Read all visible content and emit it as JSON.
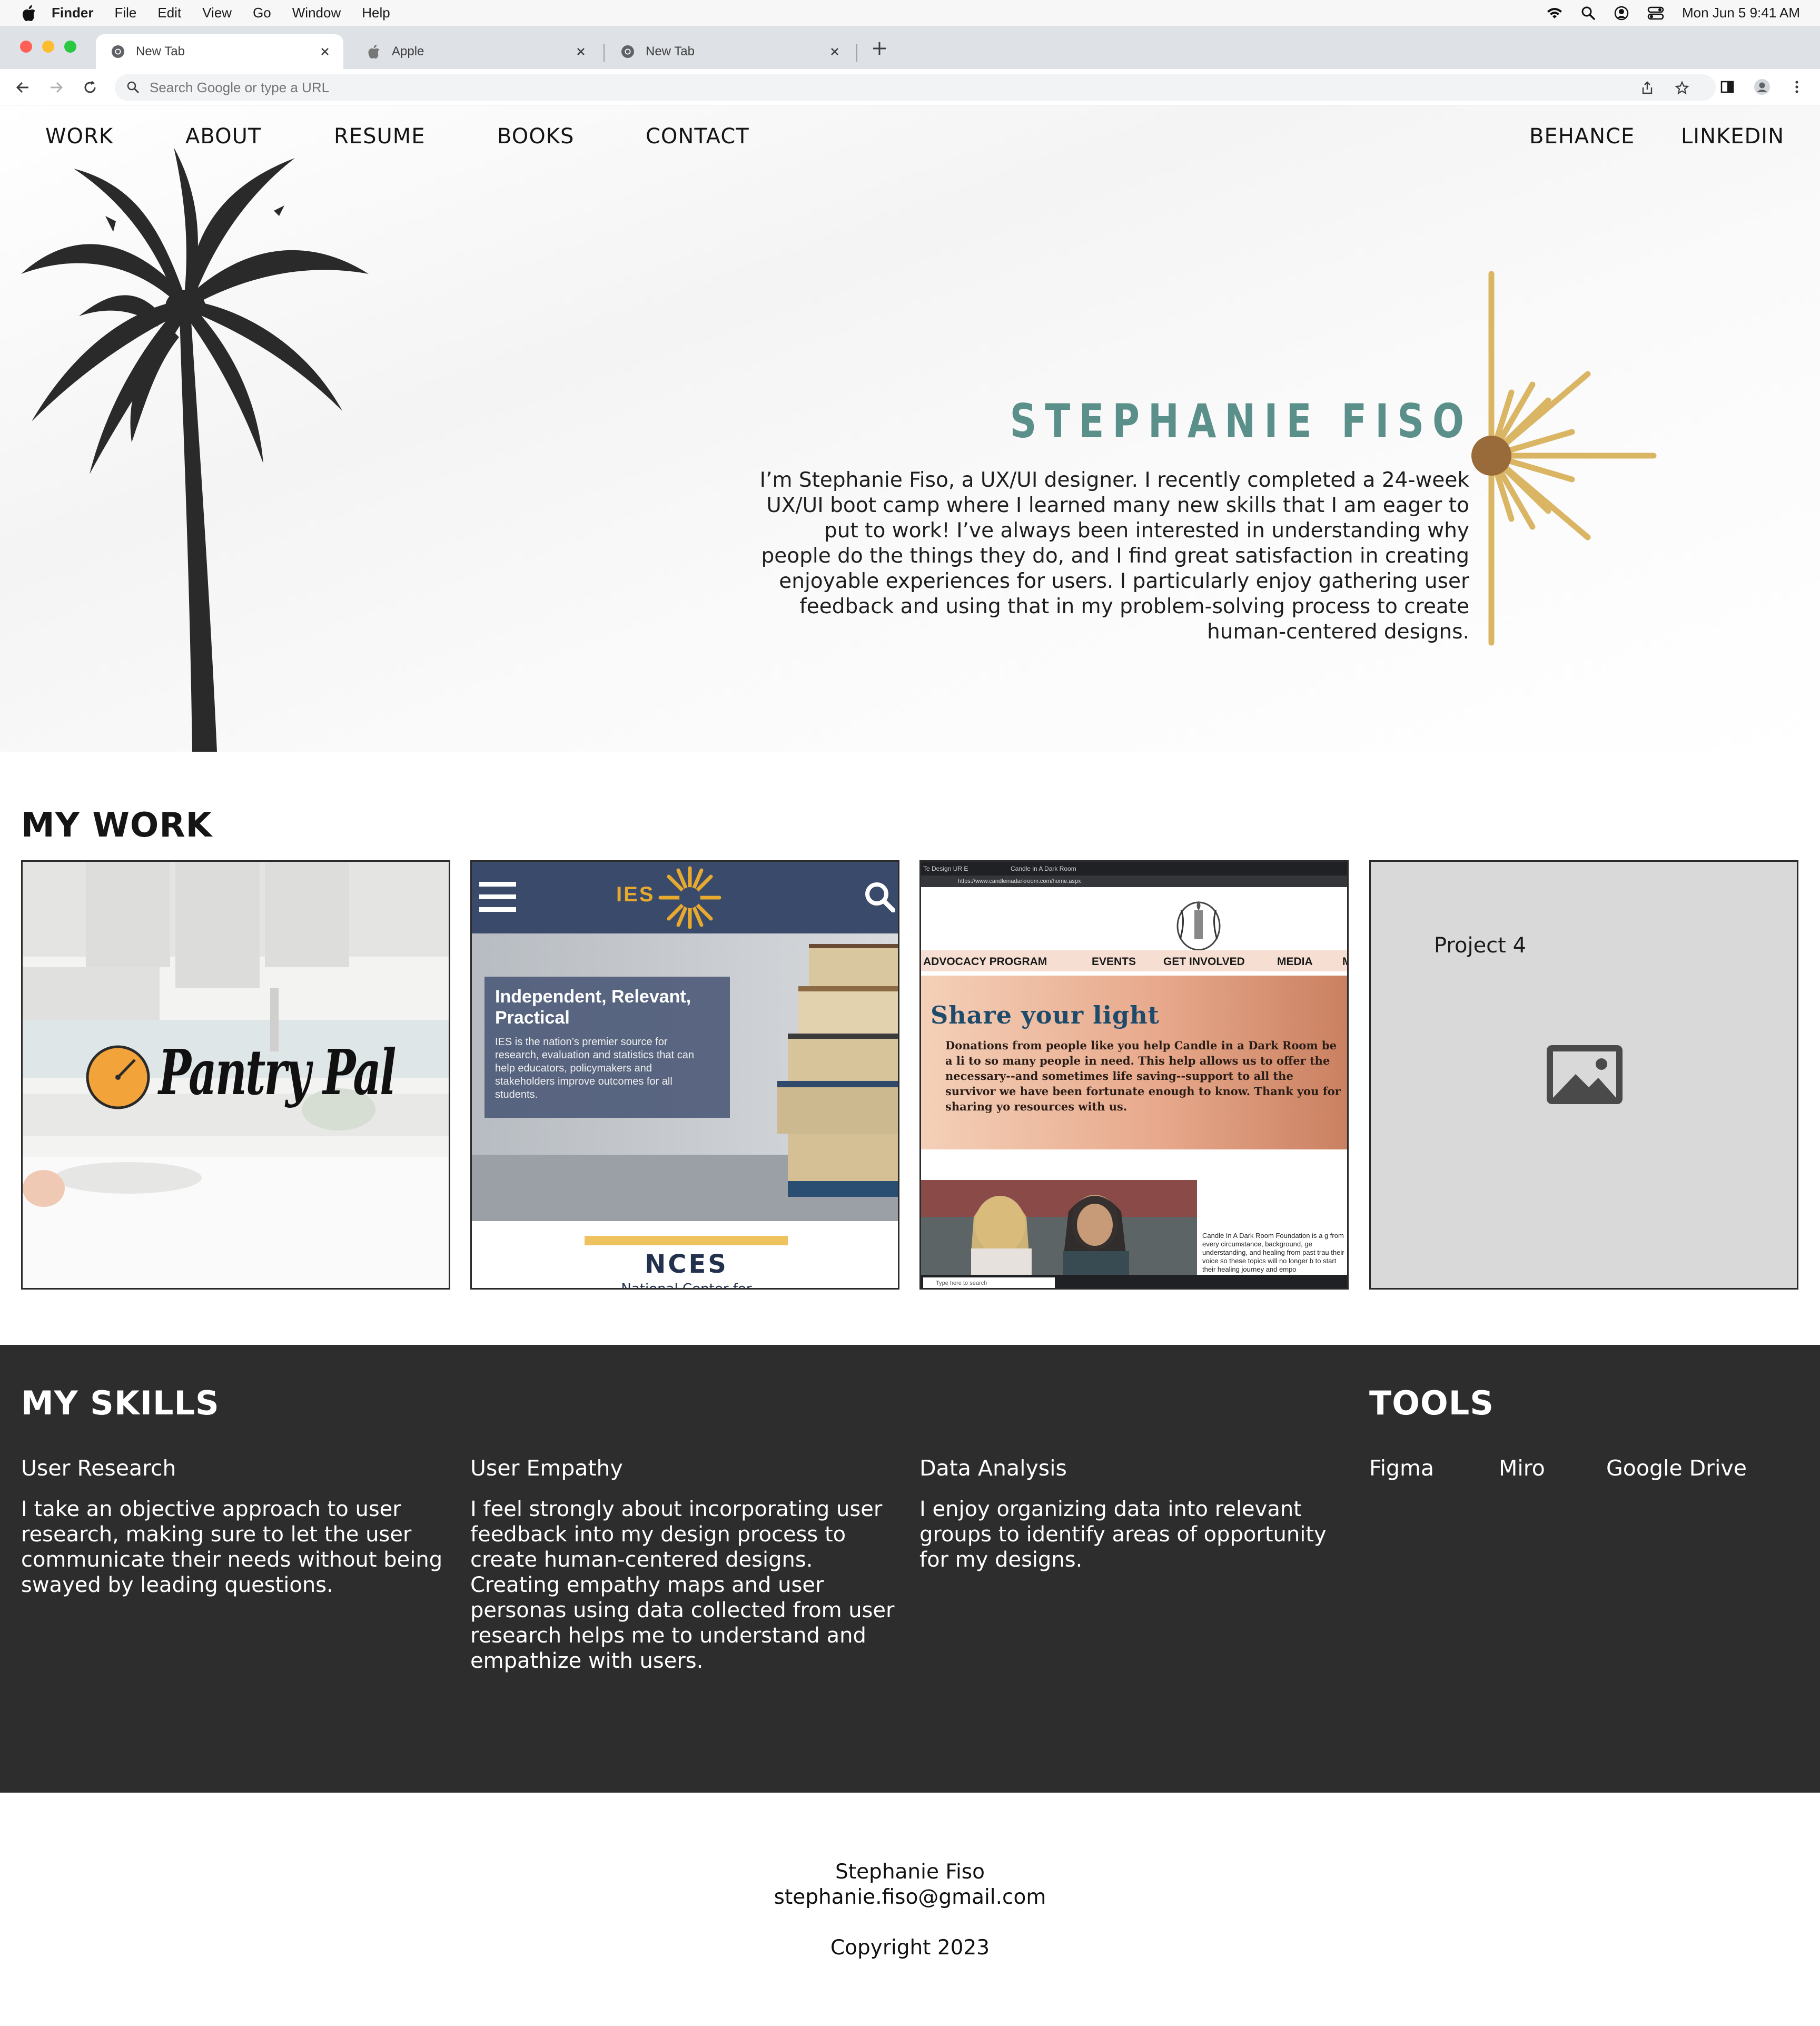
{
  "menubar": {
    "app": "Finder",
    "items": [
      "File",
      "Edit",
      "View",
      "Go",
      "Window",
      "Help"
    ],
    "datetime": "Mon Jun 5  9:41 AM"
  },
  "browser": {
    "tabs": [
      {
        "title": "New Tab",
        "icon": "chrome-icon",
        "active": true
      },
      {
        "title": "Apple",
        "icon": "apple-icon",
        "active": false
      },
      {
        "title": "New Tab",
        "icon": "chrome-icon",
        "active": false
      }
    ],
    "omnibox_placeholder": "Search Google or type a URL"
  },
  "site": {
    "nav_left": [
      "WORK",
      "ABOUT",
      "RESUME",
      "BOOKS",
      "CONTACT"
    ],
    "nav_right": [
      "BEHANCE",
      "LINKEDIN"
    ],
    "hero": {
      "name": "STEPHANIE FISO",
      "bio": "I’m Stephanie Fiso, a UX/UI designer. I recently completed a 24-week UX/UI boot camp where I learned many new skills that I am eager to put to work! I’ve always been interested in understanding why people do the things they do, and I find great satisfaction in creating enjoyable experiences for users. I particularly enjoy gathering user feedback and using that in my problem-solving process to create human-centered designs."
    },
    "work": {
      "title": "MY WORK",
      "projects": [
        {
          "logo_text": "Pantry Pal"
        },
        {
          "brand": "IES",
          "headline": "Independent, Relevant, Practical",
          "body": "IES is the nation’s premier source for research, evaluation and statistics that can help educators, policymakers and stakeholders improve outcomes for all students.",
          "footer_title": "NCES",
          "footer_sub": "National Center for"
        },
        {
          "tab1": "Te Design UR E",
          "tab2": "Candle in A Dark Room",
          "url": "https://www.candleinadarkroom.com/home.aspx",
          "nav": [
            "ADVOCACY PROGRAM",
            "EVENTS",
            "GET INVOLVED",
            "MEDIA",
            "M"
          ],
          "headline": "Share your light",
          "body": "Donations from people like you help Candle in a Dark Room be a li to so many people in need. This help allows us to offer the necessary--and sometimes life saving--support to all the survivor we have been fortunate enough to know. Thank you for sharing yo resources with us.",
          "side_text": "Candle In A Dark Room Foundation is a g from every circumstance, background, ge understanding, and healing from past trau their voice so these topics will no longer b to start their healing journey and empo",
          "taskbar_search": "Type here to search"
        },
        {
          "title": "Project 4",
          "placeholder_icon": "image-icon"
        }
      ]
    },
    "skills": {
      "title": "MY SKILLS",
      "items": [
        {
          "name": "User Research",
          "desc": "I take an objective approach to user research, making sure to let the user communicate their needs without being swayed by leading questions."
        },
        {
          "name": "User Empathy",
          "desc": "I feel strongly about incorporating user feedback into my design process to create human-centered designs. Creating empathy maps and user personas using data collected from user research helps me to understand and empathize with users."
        },
        {
          "name": "Data Analysis",
          "desc": "I enjoy organizing data into relevant groups to identify areas of opportunity for my designs."
        }
      ]
    },
    "tools": {
      "title": "TOOLS",
      "items": [
        "Figma",
        "Miro",
        "Google Drive"
      ]
    },
    "footer": {
      "name": "Stephanie Fiso",
      "email": "stephanie.fiso@gmail.com",
      "copyright": "Copyright 2023"
    }
  },
  "colors": {
    "accent_teal": "#5a8f8a",
    "sunburst_gold": "#d9b564",
    "sunburst_center": "#9a6b3a",
    "skills_bg": "#2d2d2d",
    "ies_navy": "#3a4a6b",
    "ies_gold": "#e8a92f",
    "candle_headline": "#1e4b6b"
  }
}
